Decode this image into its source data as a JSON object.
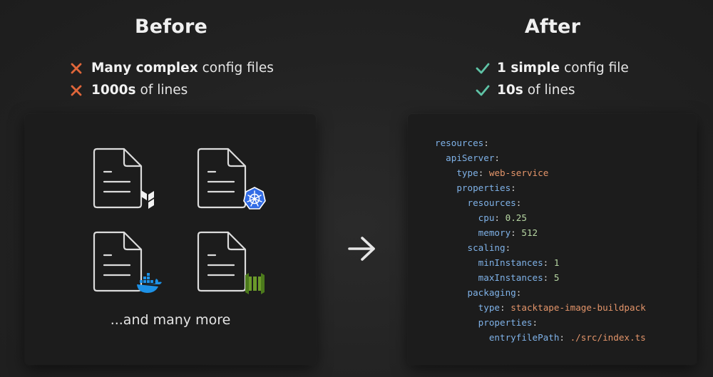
{
  "before": {
    "title": "Before",
    "bullets": [
      {
        "bold": "Many complex",
        "rest": "config files",
        "icon": "cross-icon"
      },
      {
        "bold": "1000s",
        "rest": "of lines",
        "icon": "cross-icon"
      }
    ],
    "files": [
      {
        "badge": "terraform-logo-icon"
      },
      {
        "badge": "kubernetes-logo-icon"
      },
      {
        "badge": "docker-logo-icon"
      },
      {
        "badge": "cloudformation-logo-icon"
      }
    ],
    "more_text": "...and many more"
  },
  "after": {
    "title": "After",
    "bullets": [
      {
        "bold": "1 simple",
        "rest": "config file",
        "icon": "check-icon"
      },
      {
        "bold": "10s",
        "rest": "of lines",
        "icon": "check-icon"
      }
    ],
    "code": [
      {
        "indent": 0,
        "key": "resources",
        "value": ""
      },
      {
        "indent": 1,
        "key": "apiServer",
        "value": ""
      },
      {
        "indent": 2,
        "key": "type",
        "value": "web-service"
      },
      {
        "indent": 2,
        "key": "properties",
        "value": ""
      },
      {
        "indent": 3,
        "key": "resources",
        "value": ""
      },
      {
        "indent": 4,
        "key": "cpu",
        "value": "0.25"
      },
      {
        "indent": 4,
        "key": "memory",
        "value": "512"
      },
      {
        "indent": 3,
        "key": "scaling",
        "value": ""
      },
      {
        "indent": 4,
        "key": "minInstances",
        "value": "1"
      },
      {
        "indent": 4,
        "key": "maxInstances",
        "value": "5"
      },
      {
        "indent": 3,
        "key": "packaging",
        "value": ""
      },
      {
        "indent": 4,
        "key": "type",
        "value": "stacktape-image-buildpack"
      },
      {
        "indent": 4,
        "key": "properties",
        "value": ""
      },
      {
        "indent": 5,
        "key": "entryfilePath",
        "value": "./src/index.ts"
      }
    ]
  },
  "colors": {
    "cross": "#e0663a",
    "check": "#5fc3a6",
    "code_key": "#7fb2e8",
    "code_string": "#e4956a",
    "code_number": "#b7d7a3",
    "kubernetes": "#326ce5",
    "docker": "#1d91e6",
    "cloudformation": "#6b9a2a"
  }
}
